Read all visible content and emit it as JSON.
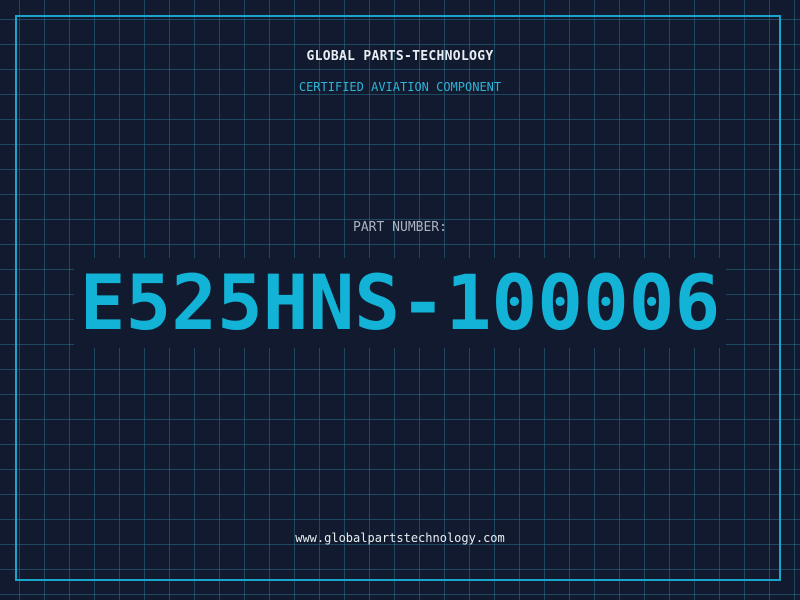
{
  "header": {
    "company": "GLOBAL PARTS-TECHNOLOGY",
    "subtitle": "CERTIFIED AVIATION COMPONENT"
  },
  "part": {
    "label": "PART NUMBER:",
    "number": "E525HNS-100006"
  },
  "footer": {
    "url": "www.globalpartstechnology.com"
  },
  "colors": {
    "background": "#111a2e",
    "grid": "#286e8c",
    "accent": "#12b3d6",
    "text": "#e8edf3"
  }
}
